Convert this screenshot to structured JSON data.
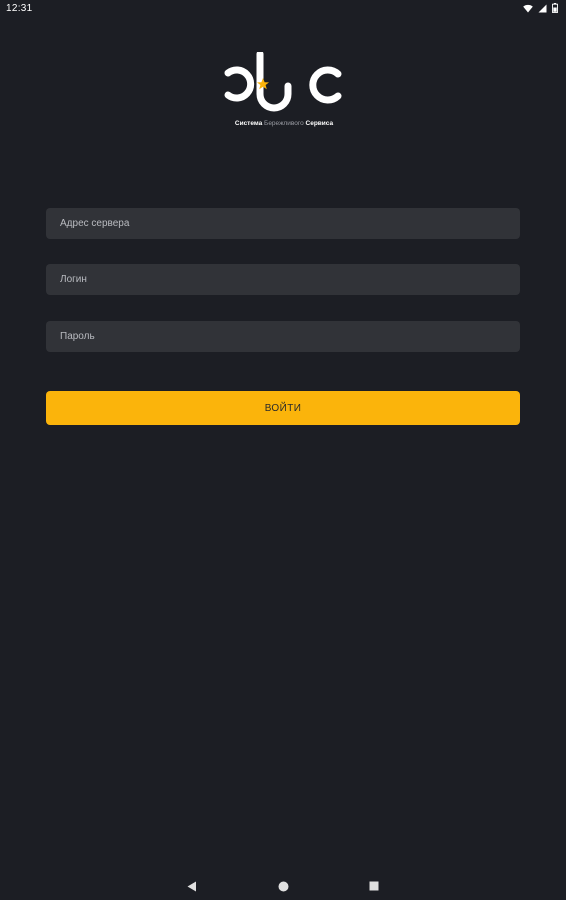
{
  "status_bar": {
    "time": "12:31",
    "icons": [
      "wifi-icon",
      "cellular-signal-icon",
      "battery-icon"
    ]
  },
  "logo": {
    "caption_bold_1": "Система",
    "caption_light": "Бережливого",
    "caption_bold_2": "Сервиса",
    "accent_color": "#fbb40b"
  },
  "form": {
    "server_placeholder": "Адрес сервера",
    "login_placeholder": "Логин",
    "password_placeholder": "Пароль",
    "submit_label": "войти"
  },
  "colors": {
    "background": "#1c1e24",
    "field_bg": "#313338",
    "button_bg": "#fbb40b"
  },
  "nav_bar": {
    "icons": [
      "back-icon",
      "home-icon",
      "recents-icon"
    ]
  }
}
